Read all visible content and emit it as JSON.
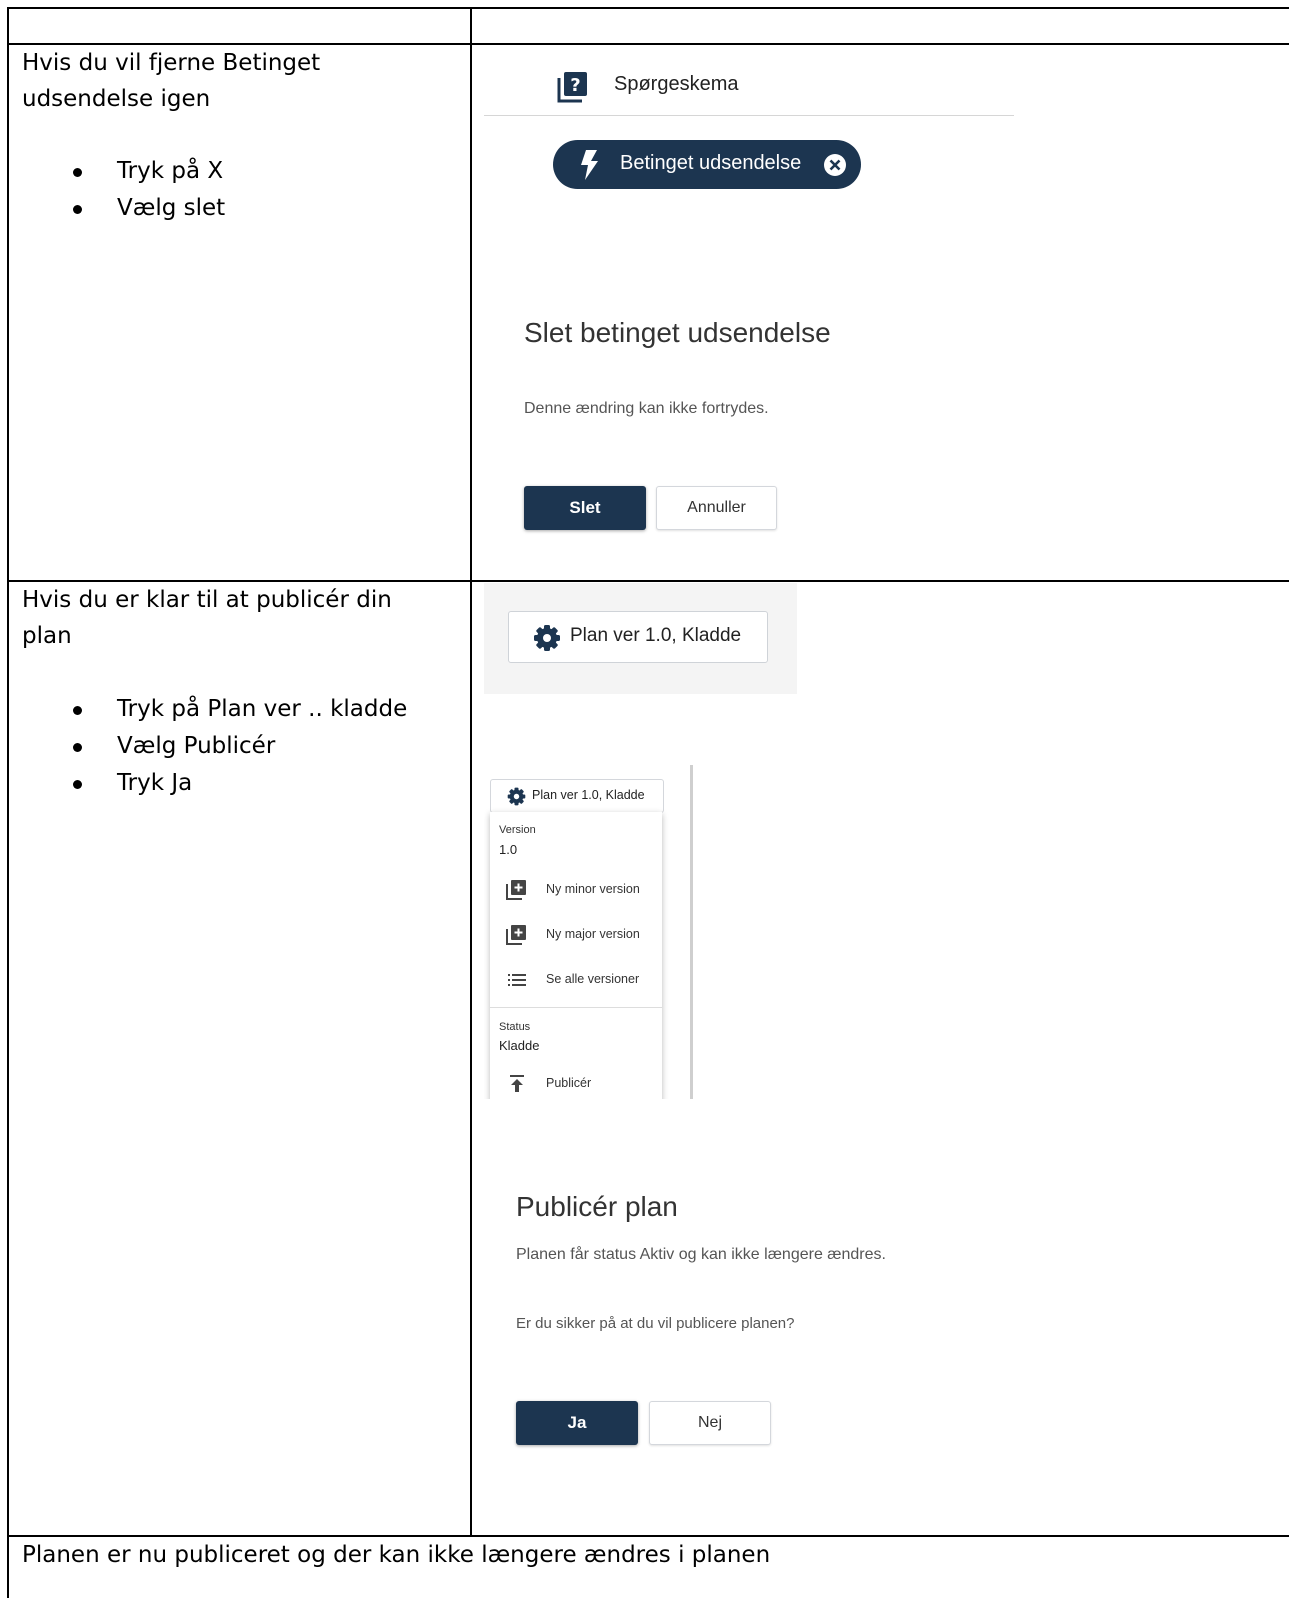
{
  "row1": {
    "instruction_lines": [
      "Hvis du vil fjerne Betinget",
      "udsendelse igen"
    ],
    "bullets": [
      "Tryk på X",
      "Vælg slet"
    ],
    "menu_label": "Spørgeskema",
    "chip_label": "Betinget udsendelse",
    "dialog": {
      "title": "Slet betinget udsendelse",
      "body": "Denne ændring kan ikke fortrydes.",
      "primary_button": "Slet",
      "secondary_button": "Annuller"
    }
  },
  "row2": {
    "instruction_lines": [
      "Hvis du er klar til at publicér din",
      "plan"
    ],
    "bullets": [
      "Tryk på Plan ver .. kladde",
      "Vælg Publicér",
      "Tryk Ja"
    ],
    "plan_button_label": "Plan ver 1.0, Kladde",
    "dropdown": {
      "button_label": "Plan ver 1.0, Kladde",
      "version_caption": "Version",
      "version_value": "1.0",
      "items": [
        "Ny minor version",
        "Ny major version",
        "Se alle versioner"
      ],
      "status_caption": "Status",
      "status_value": "Kladde",
      "publish_item": "Publicér"
    },
    "dialog": {
      "title": "Publicér plan",
      "body": "Planen får status Aktiv og kan ikke længere ændres.",
      "question": "Er du sikker på at du vil publicere planen?",
      "primary_button": "Ja",
      "secondary_button": "Nej"
    }
  },
  "footer_text": "Planen er nu publiceret og der kan ikke længere ændres i planen",
  "colors": {
    "navy": "#1c3550",
    "border": "#000000",
    "muted_text": "#555555"
  }
}
